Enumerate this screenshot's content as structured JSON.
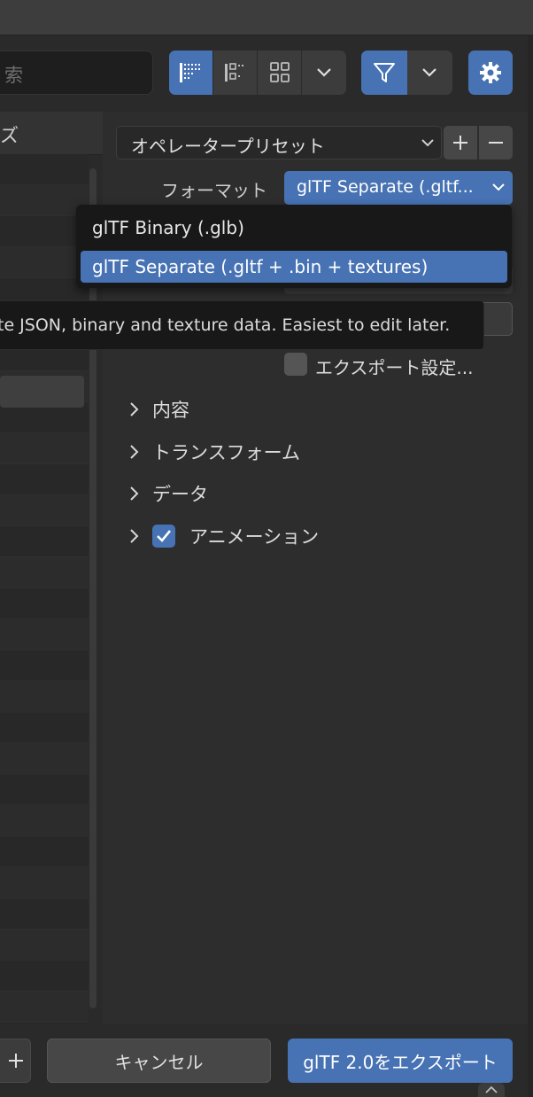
{
  "search": {
    "placeholder_fragment": "索"
  },
  "left_panel": {
    "header_fragment": "ズ"
  },
  "toolbar": {
    "view_icons": [
      "list-icon",
      "thumbnail-vertical-icon",
      "grid-icon"
    ],
    "filter_icon": "filter-icon",
    "settings_icon": "gear-icon"
  },
  "operator_preset": {
    "label": "オペレータープリセット"
  },
  "format": {
    "label": "フォーマット",
    "selected": "glTF Separate (.gltf...",
    "options": [
      "glTF Binary (.glb)",
      "glTF Separate (.gltf + .bin + textures)"
    ]
  },
  "tooltip": {
    "text": "te JSON, binary and texture data. Easiest to edit later."
  },
  "export_settings": {
    "label": "エクスポート設定...",
    "checked": false
  },
  "sections": [
    {
      "label": "内容"
    },
    {
      "label": "トランスフォーム"
    },
    {
      "label": "データ"
    },
    {
      "label": "アニメーション",
      "checked": true
    }
  ],
  "footer": {
    "cancel_label": "キャンセル",
    "export_label": "glTF 2.0をエクスポート"
  },
  "colors": {
    "accent": "#4772b3",
    "background": "#2d2d2d",
    "menu_bg": "#181818"
  }
}
